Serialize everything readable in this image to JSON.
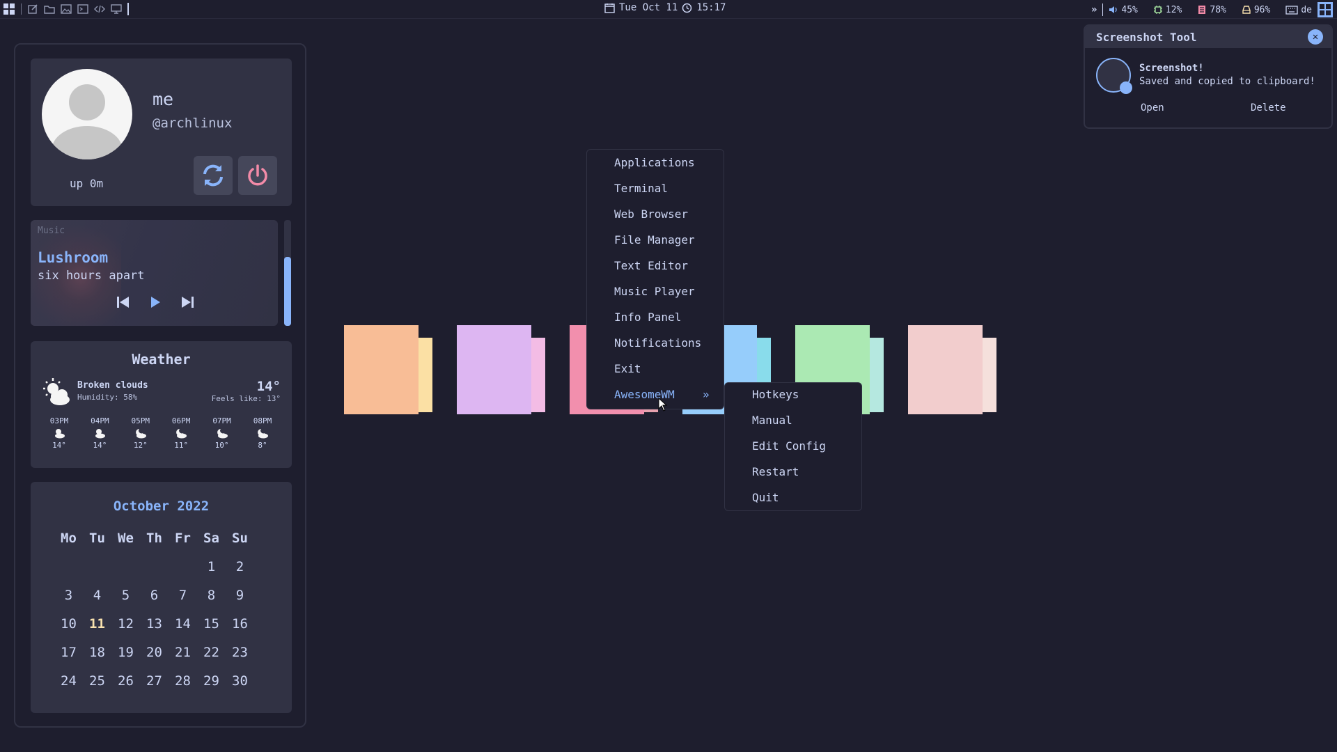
{
  "topbar": {
    "launcher_icons": [
      "grid-icon",
      "edit-icon",
      "folder-icon",
      "image-icon",
      "terminal-icon",
      "code-icon",
      "monitor-icon"
    ],
    "date": "Tue Oct 11",
    "time": "15:17",
    "expand_glyph": "»",
    "volume": "45%",
    "cpu": "12%",
    "memory": "78%",
    "disk": "96%",
    "keyboard_layout": "de"
  },
  "profile": {
    "name": "me",
    "handle": "@archlinux",
    "uptime": "up 0m"
  },
  "music": {
    "label": "Music",
    "title": "Lushroom",
    "artist": "six hours apart",
    "progress": 0.65
  },
  "weather": {
    "title": "Weather",
    "description": "Broken clouds",
    "humidity": "Humidity: 58%",
    "temp": "14°",
    "feels_like": "Feels like: 13°",
    "hourly": [
      {
        "time": "03PM",
        "icon": "sun-cloud-icon",
        "temp": "14°"
      },
      {
        "time": "04PM",
        "icon": "sun-cloud-icon",
        "temp": "14°"
      },
      {
        "time": "05PM",
        "icon": "moon-cloud-icon",
        "temp": "12°"
      },
      {
        "time": "06PM",
        "icon": "moon-cloud-icon",
        "temp": "11°"
      },
      {
        "time": "07PM",
        "icon": "moon-cloud-icon",
        "temp": "10°"
      },
      {
        "time": "08PM",
        "icon": "moon-cloud-icon",
        "temp": "8°"
      }
    ]
  },
  "calendar": {
    "title": "October 2022",
    "weekdays": [
      "Mo",
      "Tu",
      "We",
      "Th",
      "Fr",
      "Sa",
      "Su"
    ],
    "leading_blanks": 5,
    "days": [
      "1",
      "2",
      "3",
      "4",
      "5",
      "6",
      "7",
      "8",
      "9",
      "10",
      "11",
      "12",
      "13",
      "14",
      "15",
      "16",
      "17",
      "18",
      "19",
      "20",
      "21",
      "22",
      "23",
      "24",
      "25",
      "26",
      "27",
      "28",
      "29",
      "30"
    ],
    "today": "11"
  },
  "desktop_tiles": {
    "colors": [
      {
        "front": "#f8bd96",
        "back": "#fbe0a4"
      },
      {
        "front": "#ddb6f2",
        "back": "#f3bce5"
      },
      {
        "front": "#f28fad",
        "back": "#e8a2af"
      },
      {
        "front": "#96cdfb",
        "back": "#89dceb"
      },
      {
        "front": "#abe9b3",
        "back": "#b5e8e0"
      },
      {
        "front": "#f2cdcd",
        "back": "#f5e0dc"
      }
    ]
  },
  "main_menu": {
    "items": [
      "Applications",
      "Terminal",
      "Web Browser",
      "File Manager",
      "Text Editor",
      "Music Player",
      "Info Panel",
      "Notifications",
      "Exit",
      "AwesomeWM"
    ],
    "submenu_arrow": "»",
    "active_item": "AwesomeWM"
  },
  "sub_menu": {
    "items": [
      "Hotkeys",
      "Manual",
      "Edit Config",
      "Restart",
      "Quit"
    ]
  },
  "notification": {
    "app": "Screenshot Tool",
    "close_glyph": "✕",
    "title": "Screenshot!",
    "message": "Saved and copied to clipboard!",
    "actions": [
      "Open",
      "Delete"
    ]
  },
  "colors": {
    "background": "#1e1e2e",
    "surface": "#313244",
    "accent": "#89b4fa",
    "power": "#f38ba8",
    "today": "#f9e2af"
  }
}
